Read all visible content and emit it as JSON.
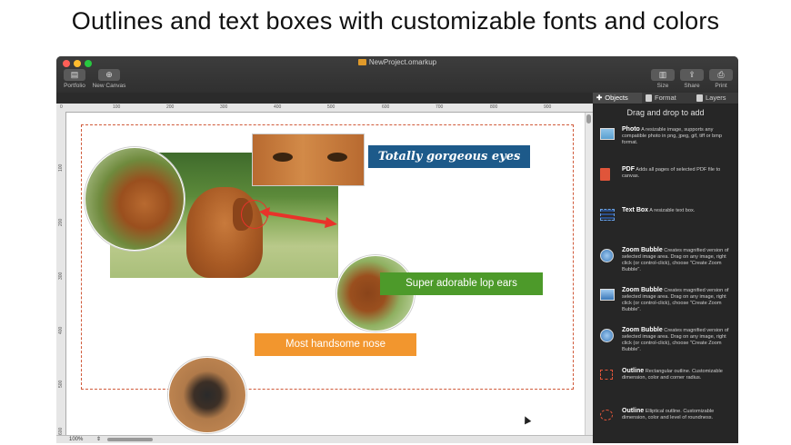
{
  "headline": "Outlines and text boxes with customizable fonts and colors",
  "window": {
    "title": "NewProject.omarkup",
    "toolbar_left": [
      {
        "label": "Portfolio",
        "icon": "portfolio-icon"
      },
      {
        "label": "New Canvas",
        "icon": "plus-circle-icon"
      }
    ],
    "toolbar_right": [
      {
        "label": "Size",
        "icon": "size-icon"
      },
      {
        "label": "Share",
        "icon": "share-icon"
      },
      {
        "label": "Print",
        "icon": "print-icon"
      }
    ],
    "colors": {
      "close": "#fe5f57",
      "minimize": "#febc2e",
      "zoom": "#28c840"
    }
  },
  "tabs": [
    {
      "label": "Objects",
      "icon": "plus-icon",
      "active": true
    },
    {
      "label": "Format",
      "icon": "pencil-icon",
      "active": false
    },
    {
      "label": "Layers",
      "icon": "layers-icon",
      "active": false
    }
  ],
  "panel": {
    "heading": "Drag and drop to add",
    "items": [
      {
        "title": "Photo",
        "desc": "A resizable image, supports any compatible photo in png, jpeg, gif, tiff or bmp format.",
        "icon": "photo-icon"
      },
      {
        "title": "PDF",
        "desc": "Adds all pages of selected PDF file to canvas.",
        "icon": "pdf-icon"
      },
      {
        "title": "Text Box",
        "desc": "A resizable text box.",
        "icon": "text-box-icon"
      },
      {
        "title": "Zoom Bubble",
        "desc": "Creates magnified version of selected image area. Drag on any image, right click (or control-click), choose \"Create Zoom Bubble\".",
        "icon": "zoom-bubble-icon"
      },
      {
        "title": "Zoom Bubble",
        "desc": "Creates magnified version of selected image area. Drag on any image, right click (or control-click), choose \"Create Zoom Bubble\".",
        "icon": "zoom-bubble-square-icon"
      },
      {
        "title": "Zoom Bubble",
        "desc": "Creates magnified version of selected image area.  Drag on any image, right click (or control-click), choose \"Create Zoom Bubble\".",
        "icon": "zoom-bubble-icon"
      },
      {
        "title": "Outline",
        "desc": "Rectangular outline. Customizable dimension, color and corner radius.",
        "icon": "rect-outline-icon"
      },
      {
        "title": "Outline",
        "desc": "Elliptical outline.  Customizable dimension, color and level of roundness.",
        "icon": "ellipse-outline-icon"
      }
    ]
  },
  "ruler": {
    "top": [
      "0",
      "100",
      "200",
      "300",
      "400",
      "500",
      "600",
      "700",
      "800",
      "900"
    ],
    "left": [
      "100",
      "200",
      "300",
      "400",
      "500",
      "600"
    ]
  },
  "status": {
    "zoom": "100%"
  },
  "canvas": {
    "label1": "Totally gorgeous eyes",
    "label2": "Super adorable lop ears",
    "label3": "Most handsome nose",
    "colors": {
      "label1": "#1d5a8a",
      "label2": "#4d9a2a",
      "label3": "#f2962e",
      "arrow": "#e8332a",
      "outline": "#d05a3a"
    }
  }
}
